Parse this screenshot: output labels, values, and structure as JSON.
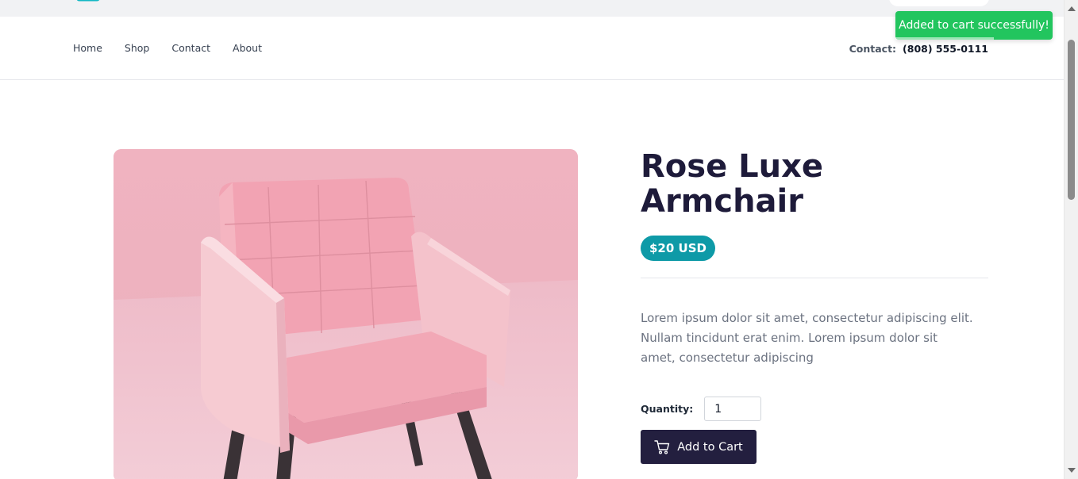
{
  "nav": {
    "links": [
      "Home",
      "Shop",
      "Contact",
      "About"
    ],
    "contact_label": "Contact:",
    "contact_number": "(808) 555-0111"
  },
  "toast": {
    "message": "Added to cart successfully!",
    "color": "#22c55e"
  },
  "product": {
    "title": "Rose Luxe Armchair",
    "price": "$20 USD",
    "description": "Lorem ipsum dolor sit amet, consectetur adipiscing elit. Nullam tincidunt erat enim. Lorem ipsum dolor sit amet, consectetur adipiscing",
    "quantity_label": "Quantity:",
    "quantity_value": "1",
    "add_to_cart_label": "Add to Cart",
    "price_color": "#0e9aa7",
    "button_color": "#231f3f"
  },
  "icons": {
    "cart": "cart-icon",
    "logo": "logo-icon"
  }
}
